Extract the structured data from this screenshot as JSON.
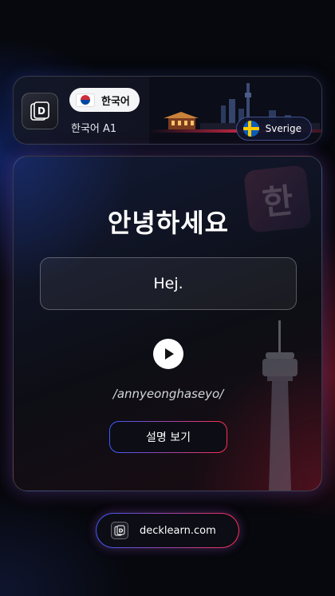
{
  "header": {
    "app_logo_icon": "deck-logo-icon",
    "language_pill": {
      "flag_icon": "south-korea-flag-icon",
      "label": "한국어"
    },
    "course_level": "한국어 A1",
    "target_language": {
      "flag_icon": "sweden-flag-icon",
      "label": "Sverige"
    },
    "background_image": "seoul-skyline"
  },
  "card": {
    "watermark_glyph": "한",
    "word": "안녕하세요",
    "translation": "Hej.",
    "play_icon": "play-icon",
    "romanization": "/annyeonghaseyo/",
    "explain_button_label": "설명 보기",
    "background_image": "seoul-tower"
  },
  "footer": {
    "site_logo_icon": "deck-logo-icon",
    "site_label": "decklearn.com"
  },
  "colors": {
    "background": "#07080d",
    "accent_blue": "#3b5bff",
    "accent_red": "#ff2e4f"
  }
}
